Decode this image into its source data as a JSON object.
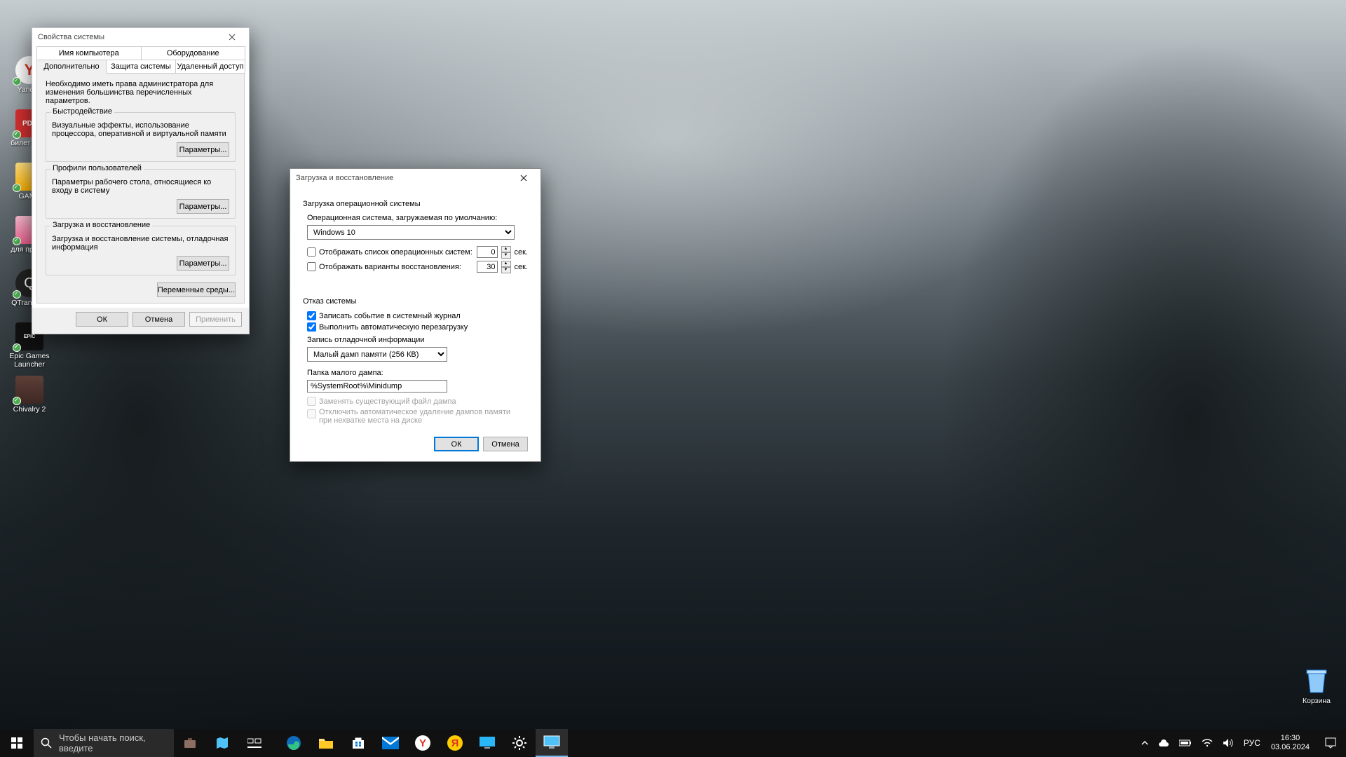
{
  "desktop": {
    "icons": [
      {
        "label": "Yandex",
        "color": "#fff"
      },
      {
        "label": "билет до…",
        "color": "#d32f2f",
        "text": "PDF"
      },
      {
        "label": "GAME",
        "color": "#ffb74d"
      },
      {
        "label": "для през…",
        "color": "#f48fb1"
      },
      {
        "label": "QTranslate",
        "color": "#222"
      },
      {
        "label": "Epic Games Launcher",
        "color": "#111",
        "text": "EPIC"
      },
      {
        "label": "Chivalry 2",
        "color": "#333"
      }
    ],
    "recycle": "Корзина"
  },
  "sysprops": {
    "title": "Свойства системы",
    "tabs_row1": [
      "Имя компьютера",
      "Оборудование"
    ],
    "tabs_row2": [
      "Дополнительно",
      "Защита системы",
      "Удаленный доступ"
    ],
    "active_tab": "Дополнительно",
    "admin_note": "Необходимо иметь права администратора для изменения большинства перечисленных параметров.",
    "groups": {
      "perf": {
        "legend": "Быстродействие",
        "desc": "Визуальные эффекты, использование процессора, оперативной и виртуальной памяти",
        "btn": "Параметры..."
      },
      "profiles": {
        "legend": "Профили пользователей",
        "desc": "Параметры рабочего стола, относящиеся ко входу в систему",
        "btn": "Параметры..."
      },
      "startup": {
        "legend": "Загрузка и восстановление",
        "desc": "Загрузка и восстановление системы, отладочная информация",
        "btn": "Параметры..."
      }
    },
    "env_btn": "Переменные среды...",
    "buttons": {
      "ok": "ОК",
      "cancel": "Отмена",
      "apply": "Применить"
    }
  },
  "startrec": {
    "title": "Загрузка и восстановление",
    "section_startup": "Загрузка операционной системы",
    "default_os_label": "Операционная система, загружаемая по умолчанию:",
    "default_os_value": "Windows 10",
    "chk_oslist": "Отображать список операционных систем:",
    "oslist_time": "0",
    "chk_recovery": "Отображать варианты восстановления:",
    "recovery_time": "30",
    "sek": "сек.",
    "section_failure": "Отказ системы",
    "chk_log": "Записать событие в системный журнал",
    "chk_restart": "Выполнить автоматическую перезагрузку",
    "dump_label": "Запись отладочной информации",
    "dump_value": "Малый дамп памяти (256 КВ)",
    "dumpdir_label": "Папка малого дампа:",
    "dumpdir_value": "%SystemRoot%\\Minidump",
    "chk_overwrite": "Заменять существующий файл дампа",
    "chk_disable_auto": "Отключить автоматическое удаление дампов памяти при нехватке места на диске",
    "buttons": {
      "ok": "ОК",
      "cancel": "Отмена"
    }
  },
  "taskbar": {
    "search_placeholder": "Чтобы начать поиск, введите",
    "lang": "РУС",
    "time": "16:30",
    "date": "03.06.2024"
  }
}
